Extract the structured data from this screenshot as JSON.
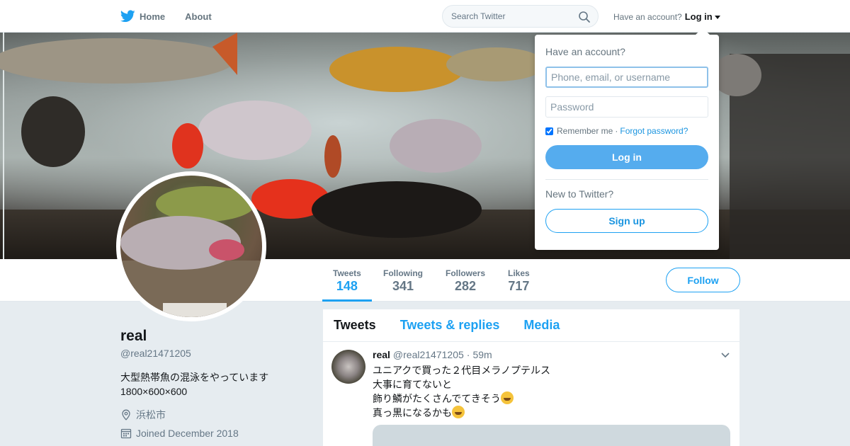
{
  "nav": {
    "home_label": "Home",
    "about_label": "About",
    "search_placeholder": "Search Twitter",
    "have_account": "Have an account?",
    "login_label": "Log in"
  },
  "login_dropdown": {
    "title": "Have an account?",
    "username_placeholder": "Phone, email, or username",
    "password_placeholder": "Password",
    "remember_label": "Remember me",
    "separator": "·",
    "forgot_label": "Forgot password?",
    "login_button": "Log in",
    "new_label": "New to Twitter?",
    "signup_button": "Sign up",
    "remember_checked": true
  },
  "stats": [
    {
      "label": "Tweets",
      "value": "148",
      "active": true
    },
    {
      "label": "Following",
      "value": "341"
    },
    {
      "label": "Followers",
      "value": "282"
    },
    {
      "label": "Likes",
      "value": "717"
    }
  ],
  "follow_button": "Follow",
  "profile": {
    "name": "real",
    "handle": "@real21471205",
    "bio_line1": "大型熱帯魚の混泳をやっています",
    "bio_line2": "1800×600×600",
    "location": "浜松市",
    "joined": "Joined December 2018"
  },
  "timeline": {
    "tabs": [
      "Tweets",
      "Tweets & replies",
      "Media"
    ],
    "tweet": {
      "name": "real",
      "handle": "@real21471205",
      "dot": "·",
      "time": "59m",
      "lines": [
        "ユニアクで買った２代目メラノプテルス",
        "大事に育てないと",
        "飾り鱗がたくさんでてきそう",
        "真っ黒になるかも"
      ]
    }
  },
  "colors": {
    "accent": "#1da1f2",
    "login_button": "#55acee",
    "background": "#e6ecf0"
  }
}
